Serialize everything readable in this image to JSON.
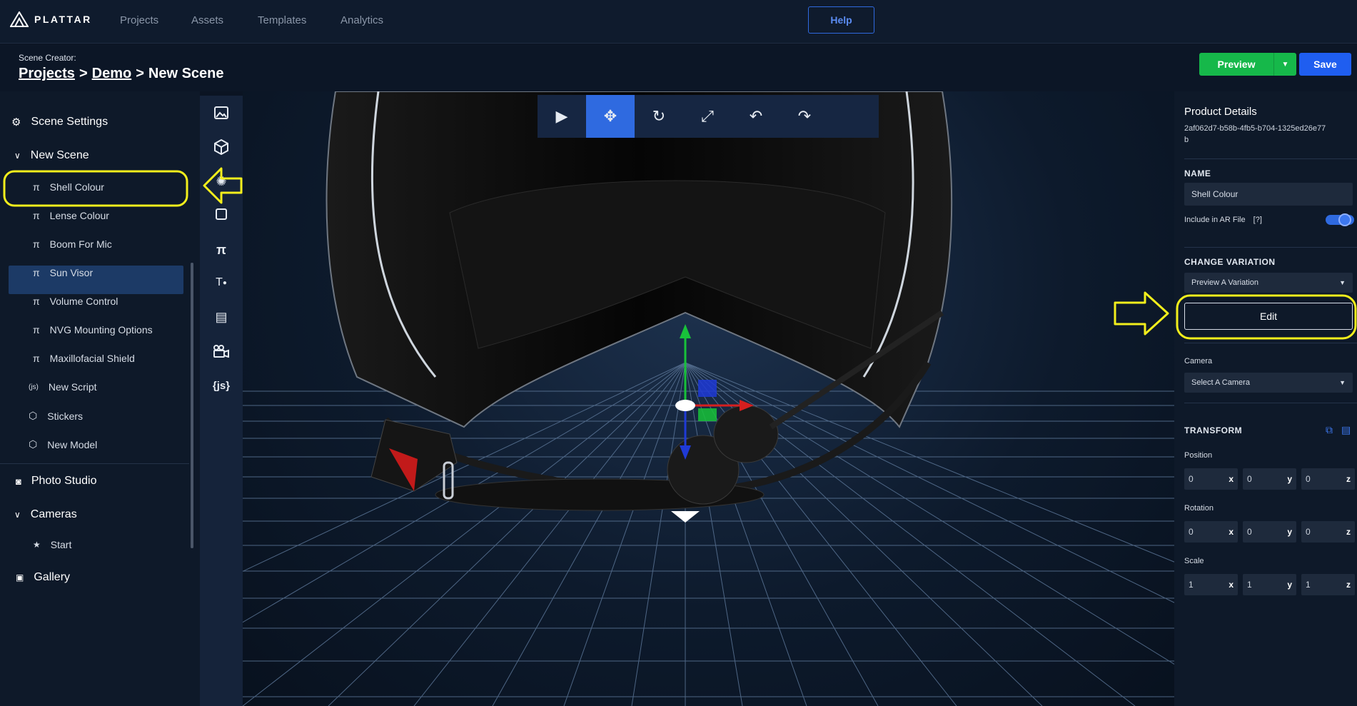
{
  "topnav": {
    "logo_text": "PLATTAR",
    "links": [
      "Projects",
      "Assets",
      "Templates",
      "Analytics"
    ],
    "help_label": "Help"
  },
  "subbar": {
    "creator_label": "Scene Creator:",
    "breadcrumb": [
      {
        "label": "Projects"
      },
      {
        "sep": ">"
      },
      {
        "label": "Demo"
      },
      {
        "sep": ">"
      },
      {
        "label": "New Scene"
      }
    ],
    "preview_label": "Preview",
    "save_label": "Save"
  },
  "sidebar": {
    "scene_settings": "Scene Settings",
    "new_scene": "New Scene",
    "children": [
      {
        "label": "Shell Colour",
        "icon": "variation-icon"
      },
      {
        "label": "Lense Colour",
        "icon": "variation-icon"
      },
      {
        "label": "Boom For Mic",
        "icon": "variation-icon"
      },
      {
        "label": "Sun Visor",
        "icon": "variation-icon"
      },
      {
        "label": "Volume Control",
        "icon": "variation-icon"
      },
      {
        "label": "NVG Mounting Options",
        "icon": "variation-icon"
      },
      {
        "label": "Maxillofacial Shield",
        "icon": "variation-icon"
      },
      {
        "label": "New Script",
        "icon": "script-icon"
      },
      {
        "label": "Stickers",
        "icon": "cube-icon"
      },
      {
        "label": "New Model",
        "icon": "cube-icon"
      }
    ],
    "photo_studio": "Photo Studio",
    "cameras": "Cameras",
    "camera_children": [
      {
        "label": "Start"
      }
    ],
    "gallery": "Gallery"
  },
  "toolcol": {
    "js_label": "{js}",
    "text_label": "T"
  },
  "viewport_toolbar": [
    "play",
    "move",
    "rotate",
    "scale",
    "undo",
    "redo"
  ],
  "details": {
    "title": "Product Details",
    "id": "2af062d7-b58b-4fb5-b704-1325ed26e77b",
    "name_heading": "NAME",
    "name_value": "Shell Colour",
    "include_ar_label": "Include in AR File",
    "include_ar_help": "[?]",
    "include_ar_on": true,
    "change_variation_heading": "CHANGE VARIATION",
    "variation_select": "Preview A Variation",
    "edit_label": "Edit",
    "camera_label": "Camera",
    "camera_select": "Select A Camera",
    "transform_heading": "TRANSFORM",
    "position_label": "Position",
    "rotation_label": "Rotation",
    "scale_label": "Scale",
    "position": [
      "0",
      "0",
      "0"
    ],
    "rotation": [
      "0",
      "0",
      "0"
    ],
    "scale": [
      "1",
      "1",
      "1"
    ],
    "axes": [
      "x",
      "y",
      "z"
    ]
  },
  "colors": {
    "accent": "#2f6ae0",
    "preview_green": "#16b84a",
    "highlight_yellow": "#f2ee1c"
  }
}
